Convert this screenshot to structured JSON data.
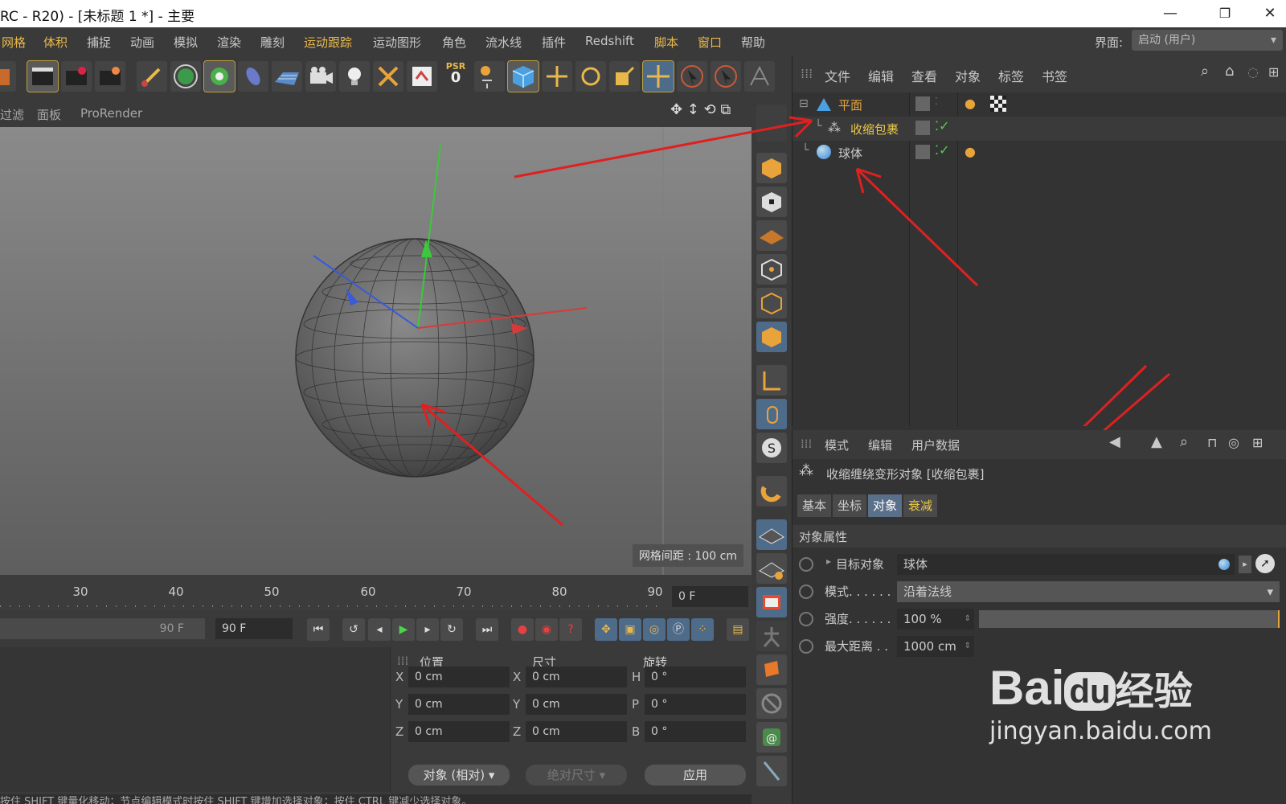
{
  "window": {
    "title": "RC - R20) - [未标题 1 *] - 主要",
    "minimize": "—",
    "restore": "❐",
    "close": "✕"
  },
  "menubar": {
    "items": [
      "网格",
      "体积",
      "捕捉",
      "动画",
      "模拟",
      "渲染",
      "雕刻",
      "运动跟踪",
      "运动图形",
      "角色",
      "流水线",
      "插件",
      "Redshift",
      "脚本",
      "窗口",
      "帮助"
    ],
    "interface_label": "界面:",
    "interface_value": "启动 (用户)"
  },
  "toolbar": {
    "psr_label": "PSR",
    "psr_value": "0",
    "icons": [
      "render-region-icon",
      "render-view-icon",
      "render-picture-viewer-icon",
      "render-settings-icon",
      "pen-icon",
      "cube-select-icon",
      "deformer-icon",
      "spline-icon",
      "floor-icon",
      "camera-icon",
      "light-icon",
      "xray-icon",
      "scene-icon",
      "psr-icon",
      "axis-icon",
      "cube-object-icon",
      "move-icon",
      "rotate-icon",
      "scale-icon",
      "move-all-icon",
      "select-live-icon",
      "select-rect-icon",
      "joint-icon"
    ]
  },
  "viewport": {
    "menu": [
      "过滤",
      "面板",
      "ProRender"
    ],
    "grid_spacing": "网格间距 : 100 cm"
  },
  "timeline": {
    "ticks": [
      "30",
      "40",
      "50",
      "60",
      "70",
      "80",
      "90"
    ],
    "current_frame": "0 F"
  },
  "playback": {
    "end_frame_slider": "90 F",
    "end_frame": "90 F"
  },
  "coordinates": {
    "headers": [
      "位置",
      "尺寸",
      "旋转"
    ],
    "position": {
      "x": "0 cm",
      "y": "0 cm",
      "z": "0 cm"
    },
    "size": {
      "x": "0 cm",
      "y": "0 cm",
      "z": "0 cm"
    },
    "rotation": {
      "h": "0 °",
      "p": "0 °",
      "b": "0 °"
    },
    "axis_labels_pos": [
      "X",
      "Y",
      "Z"
    ],
    "axis_labels_rot": [
      "H",
      "P",
      "B"
    ],
    "mode_button": "对象 (相对)",
    "size_button": "绝对尺寸",
    "apply_button": "应用"
  },
  "status_bar": "按住 SHIFT 键量化移动；节点编辑模式时按住 SHIFT 键增加选择对象；按住 CTRL 键减少选择对象。",
  "object_manager": {
    "menu": [
      "文件",
      "编辑",
      "查看",
      "对象",
      "标签",
      "书签"
    ],
    "objects": [
      {
        "name": "平面",
        "color": "#e8a33a"
      },
      {
        "name": "收缩包裹",
        "color": "#e8c84a"
      },
      {
        "name": "球体",
        "color": "#cccccc"
      }
    ]
  },
  "attribute_manager": {
    "menu": [
      "模式",
      "编辑",
      "用户数据"
    ],
    "object_title": "收缩缠绕变形对象 [收缩包裹]",
    "tabs": [
      "基本",
      "坐标",
      "对象",
      "衰减"
    ],
    "section_title": "对象属性",
    "properties": [
      {
        "label": "目标对象",
        "value": "球体"
      },
      {
        "label": "模式. . . . . .",
        "value": "沿着法线"
      },
      {
        "label": "强度. . . . . .",
        "value": "100 %"
      },
      {
        "label": "最大距离 . .",
        "value": "1000 cm"
      }
    ],
    "strength_fraction": 1.0
  },
  "watermark": {
    "brand": "Bai",
    "brand_du": "du",
    "brand_cn": "经验",
    "url": "jingyan.baidu.com"
  },
  "colors": {
    "accent_blue": "#4f6b8a",
    "highlight_yellow": "#e8b84a",
    "arrow_red": "#e02020"
  }
}
